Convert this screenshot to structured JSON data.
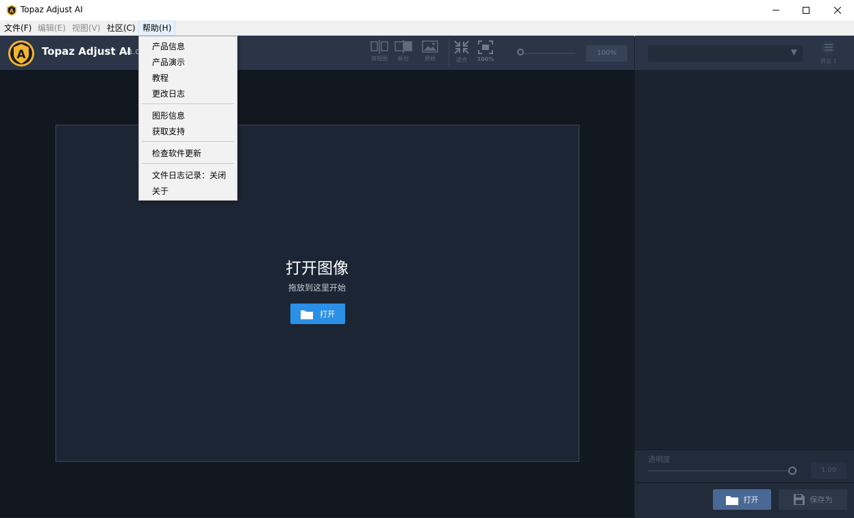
{
  "window": {
    "title": "Topaz Adjust AI",
    "controls": {
      "minimize": "—",
      "maximize": "☐",
      "close": "✕"
    }
  },
  "menubar": {
    "items": [
      {
        "label": "文件(F)",
        "enabled": true
      },
      {
        "label": "编辑(E)",
        "enabled": false
      },
      {
        "label": "视图(V)",
        "enabled": false
      },
      {
        "label": "社区(C)",
        "enabled": true
      },
      {
        "label": "帮助(H)",
        "enabled": true,
        "open": true
      }
    ]
  },
  "help_menu": {
    "groups": [
      [
        "产品信息",
        "产品演示",
        "教程",
        "更改日志"
      ],
      [
        "图形信息",
        "获取支持"
      ],
      [
        "检查软件更新"
      ],
      [
        "文件日志记录：关闭",
        "关于"
      ]
    ]
  },
  "header": {
    "app_name": "Topaz Adjust AI",
    "version": "v1.0.",
    "logo_letter": "A",
    "toolbar": [
      {
        "icon": "dual-view-icon",
        "label": "双视图"
      },
      {
        "icon": "split-icon",
        "label": "拆分"
      },
      {
        "icon": "original-image-icon",
        "label": "原始"
      },
      {
        "icon": "fit-icon",
        "label": "适合"
      },
      {
        "icon": "actual-size-icon",
        "label": "100%"
      }
    ],
    "zoom_value": "100%"
  },
  "canvas": {
    "title": "打开图像",
    "subtitle": "拖放到这里开始",
    "open_label": "打开"
  },
  "right_panel": {
    "preset_select": "",
    "icon_label": "界面 1",
    "opacity_label": "透明度",
    "opacity_value": "1.00",
    "open_label": "打开",
    "save_label": "保存为"
  },
  "colors": {
    "accent_blue": "#2b8fe6",
    "logo_gold": "#f2b630",
    "header_bg": "#2a3548",
    "canvas_bg": "#1c2534"
  }
}
